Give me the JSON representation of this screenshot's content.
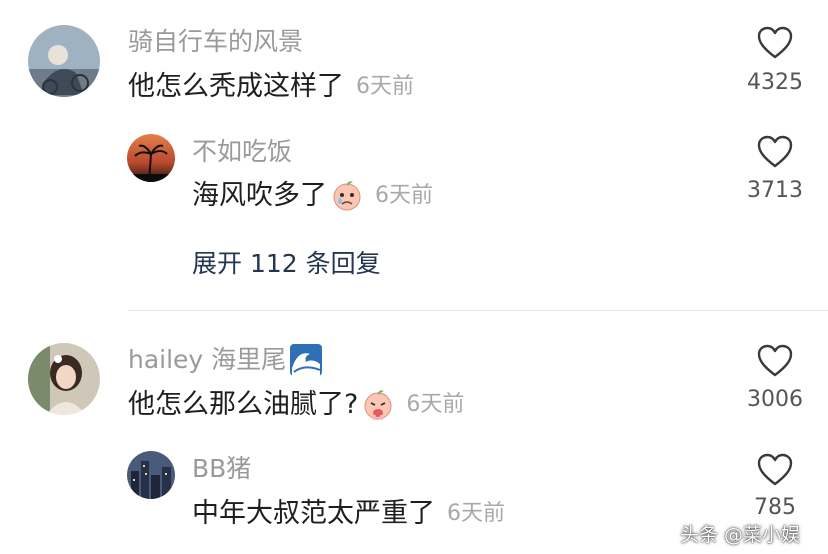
{
  "comments": [
    {
      "username": "骑自行车的风景",
      "text": "他怎么秃成这样了",
      "time": "6天前",
      "likes": "4325",
      "avatar_icon": "user-avatar-bicycle",
      "replies": [
        {
          "username": "不如吃饭",
          "text": "海风吹多了",
          "time": "6天前",
          "likes": "3713",
          "emoji_icon": "crying-face-emoji",
          "avatar_icon": "user-avatar-sunset-palm"
        }
      ],
      "expand_label": "展开 112 条回复"
    },
    {
      "username": "hailey 海里尾",
      "username_emoji_icon": "wave-emoji",
      "text": "他怎么那么油腻了?",
      "time": "6天前",
      "likes": "3006",
      "emoji_icon": "vomiting-face-emoji",
      "avatar_icon": "user-avatar-girl",
      "replies": [
        {
          "username": "BB猪",
          "text": "中年大叔范太严重了",
          "time": "6天前",
          "likes": "785",
          "avatar_icon": "user-avatar-city-night"
        }
      ]
    }
  ],
  "watermark": "头条 @菜小娱",
  "colors": {
    "username": "#9a9a9a",
    "text": "#1f1f1f",
    "time": "#a8a8a8",
    "expand": "#23364e",
    "divider": "#e9e9e9"
  }
}
